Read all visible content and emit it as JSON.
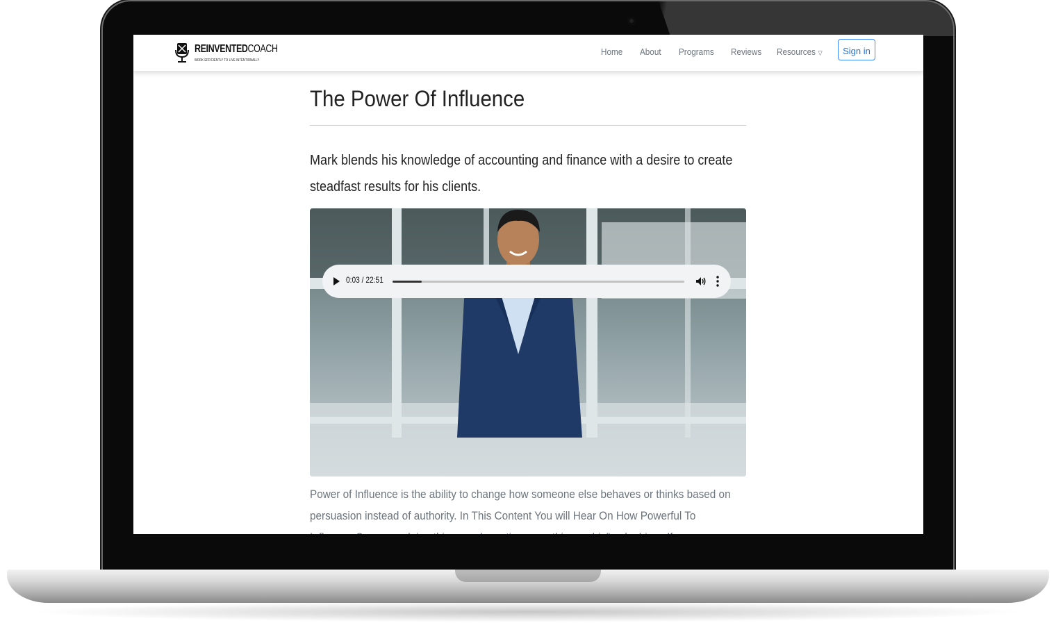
{
  "device": "laptop-mockup",
  "site": {
    "logo": {
      "word_bold": "REINVENTED",
      "word_light": "COACH",
      "tagline": "WORK EFFICIENTLY TO LIVE INTENTIONALLY"
    },
    "nav": {
      "items": [
        {
          "label": "Home"
        },
        {
          "label": "About"
        },
        {
          "label": "Programs"
        },
        {
          "label": "Reviews"
        },
        {
          "label": "Resources",
          "has_dropdown": true
        }
      ],
      "sign_in_label": "Sign in"
    }
  },
  "page": {
    "title": "The Power Of Influence",
    "lead": "Mark blends his knowledge of accounting and finance with a desire to create steadfast results for his clients.",
    "body": "Power of Influence is the ability to change how someone else behaves or thinks based on persuasion instead of authority. In This Content You will Hear On How Powerful To Influence Someone doing things and creating something as big” ... by himself..."
  },
  "audio_player": {
    "time_display": "0:03 / 22:51",
    "progress_fraction": 0.1,
    "icons": [
      "play-icon",
      "volume-icon",
      "more-options-icon"
    ]
  },
  "colors": {
    "accent": "#1e73d8",
    "nav_text": "#6c757d",
    "heading": "#222222",
    "body_text": "#6c757d"
  }
}
